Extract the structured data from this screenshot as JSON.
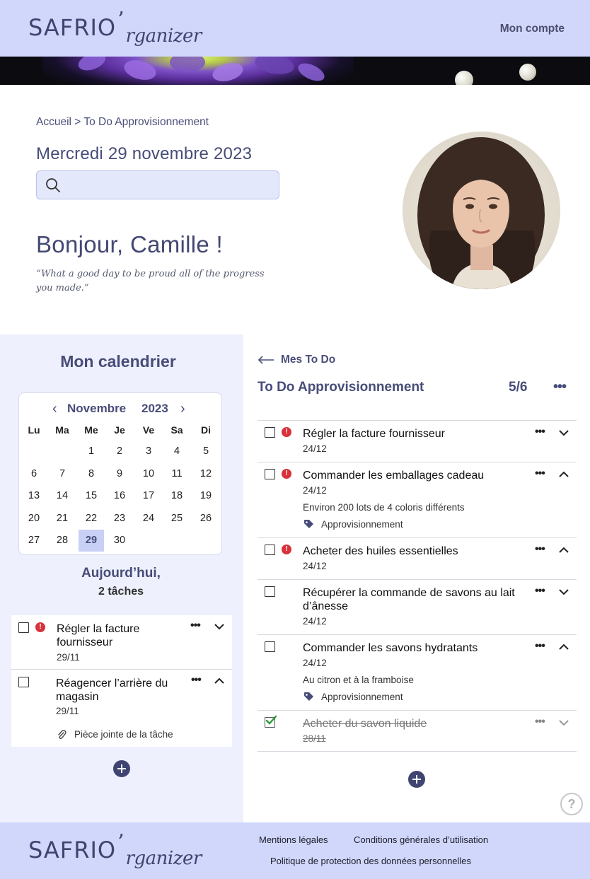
{
  "header": {
    "logo_main": "SAFRIO",
    "logo_apostrophe": "’",
    "logo_script": "rganizer",
    "account_link": "Mon compte"
  },
  "breadcrumb": {
    "home": "Accueil",
    "separator": " > ",
    "current": "To Do Approvisionnement"
  },
  "date": "Mercredi 29 novembre 2023",
  "search": {
    "placeholder": "",
    "value": ""
  },
  "greeting": "Bonjour, Camille !",
  "quote": "“What a good day to be proud  all of the progress you made.”",
  "calendar": {
    "title": "Mon calendrier",
    "month": "Novembre",
    "year": "2023",
    "prev_icon": "chevron-left-icon",
    "next_icon": "chevron-right-icon",
    "weekdays": [
      "Lu",
      "Ma",
      "Me",
      "Je",
      "Ve",
      "Sa",
      "Di"
    ],
    "weeks": [
      [
        "",
        "",
        "1",
        "2",
        "3",
        "4",
        "5"
      ],
      [
        "6",
        "7",
        "8",
        "9",
        "10",
        "11",
        "12"
      ],
      [
        "13",
        "14",
        "15",
        "16",
        "17",
        "18",
        "19"
      ],
      [
        "20",
        "21",
        "22",
        "23",
        "24",
        "25",
        "26"
      ],
      [
        "27",
        "28",
        "29",
        "30",
        "",
        "",
        ""
      ]
    ],
    "today": "29"
  },
  "today_panel": {
    "title": "Aujourd’hui,",
    "count": "2 tâches",
    "tasks": [
      {
        "title": "Régler la facture fournisseur",
        "date": "29/11",
        "urgent": true,
        "expanded": false
      },
      {
        "title": "Réagencer l’arrière du magasin",
        "date": "29/11",
        "urgent": false,
        "expanded": true,
        "attachment": "Pièce jointe de la tâche"
      }
    ]
  },
  "todo": {
    "back_label": "Mes To Do",
    "title": "To Do Approvisionnement",
    "count": "5/6",
    "tasks": [
      {
        "title": "Régler la facture fournisseur",
        "date": "24/12",
        "urgent": true,
        "expanded": false,
        "done": false
      },
      {
        "title": "Commander les emballages cadeau",
        "date": "24/12",
        "urgent": true,
        "expanded": true,
        "done": false,
        "note": "Environ 200 lots de 4 coloris différents",
        "tag": "Approvisionnement"
      },
      {
        "title": "Acheter des huiles essentielles",
        "date": "24/12",
        "urgent": true,
        "expanded": true,
        "done": false
      },
      {
        "title": "Récupérer la commande de savons au lait d’ânesse",
        "date": "24/12",
        "urgent": false,
        "expanded": false,
        "done": false
      },
      {
        "title": "Commander les savons hydratants",
        "date": "24/12",
        "urgent": false,
        "expanded": true,
        "done": false,
        "note": "Au citron et à la framboise",
        "tag": "Approvisionnement"
      },
      {
        "title": "Acheter du savon liquide",
        "date": "28/11",
        "urgent": false,
        "expanded": false,
        "done": true
      }
    ]
  },
  "help_label": "?",
  "footer": {
    "legal": "Mentions légales",
    "terms": "Conditions générales d’utilisation",
    "privacy": "Politique de protection des données  personnelles"
  },
  "colors": {
    "primary": "#474c78",
    "header_bg": "#d0d7fb",
    "panel_bg": "#eef0fd",
    "urgent": "#d8323a",
    "check_green": "#2e9c3a"
  }
}
